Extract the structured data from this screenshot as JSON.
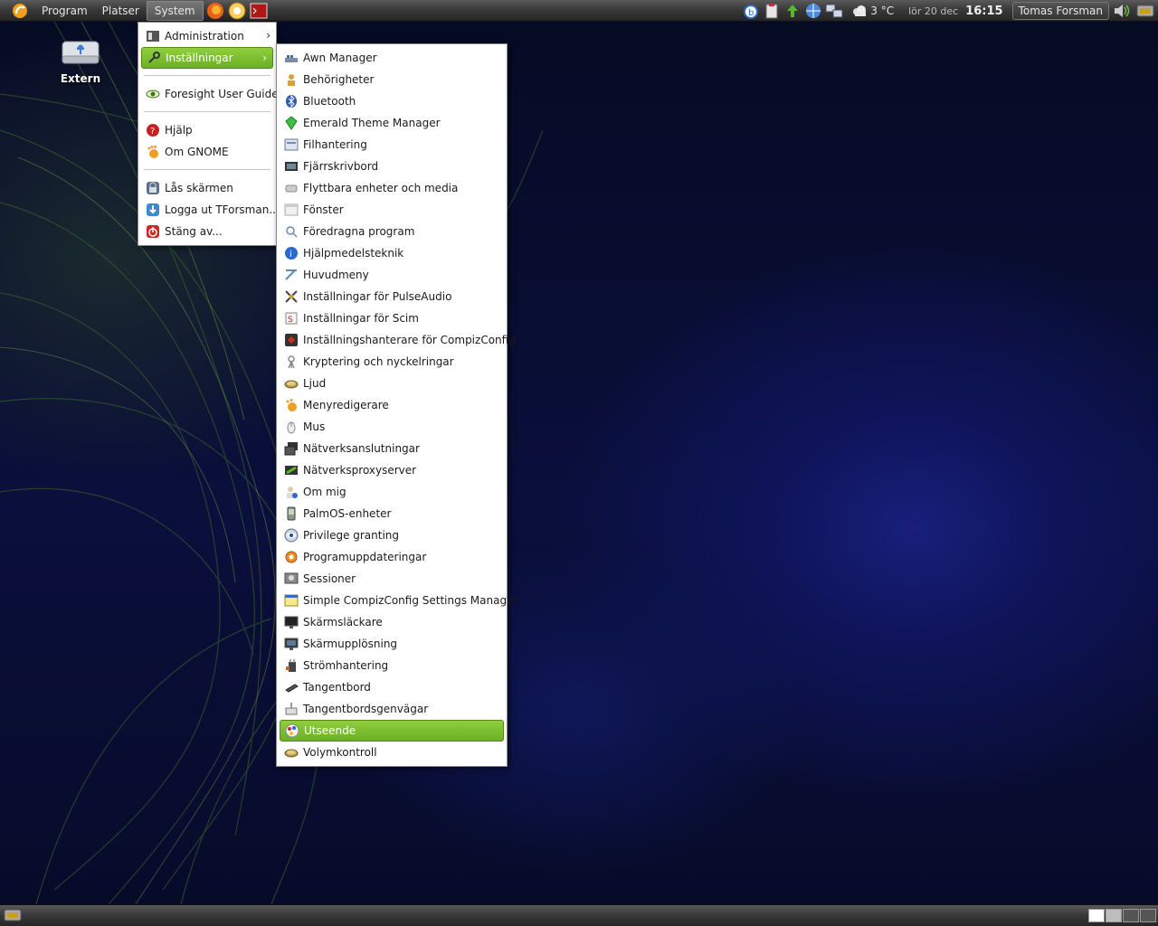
{
  "top_panel": {
    "menus": [
      "Program",
      "Platser",
      "System"
    ],
    "active_menu": "System",
    "weather": "3 °C",
    "date": "lör 20 dec",
    "time": "16:15",
    "user": "Tomas Forsman"
  },
  "desktop": {
    "icons": [
      {
        "label": "Extern",
        "icon": "usb-drive-icon"
      }
    ]
  },
  "system_menu": {
    "items": [
      {
        "label": "Administration",
        "icon": "administration-icon",
        "submenu": true
      },
      {
        "label": "Inställningar",
        "icon": "preferences-icon",
        "submenu": true,
        "highlighted": true
      },
      {
        "separator": true
      },
      {
        "label": "Foresight User Guide",
        "icon": "eye-icon"
      },
      {
        "separator": true
      },
      {
        "label": "Hjälp",
        "icon": "help-icon"
      },
      {
        "label": "Om GNOME",
        "icon": "gnome-foot-icon"
      },
      {
        "separator": true
      },
      {
        "label": "Lås skärmen",
        "icon": "lock-screen-icon"
      },
      {
        "label": "Logga ut TForsman...",
        "icon": "logout-icon"
      },
      {
        "label": "Stäng av...",
        "icon": "shutdown-icon"
      }
    ]
  },
  "settings_menu": {
    "items": [
      {
        "label": "Awn Manager",
        "icon": "awn-icon"
      },
      {
        "label": "Behörigheter",
        "icon": "permissions-icon"
      },
      {
        "label": "Bluetooth",
        "icon": "bluetooth-icon"
      },
      {
        "label": "Emerald Theme Manager",
        "icon": "emerald-icon"
      },
      {
        "label": "Filhantering",
        "icon": "file-management-icon"
      },
      {
        "label": "Fjärrskrivbord",
        "icon": "remote-desktop-icon"
      },
      {
        "label": "Flyttbara enheter och media",
        "icon": "removable-media-icon"
      },
      {
        "label": "Fönster",
        "icon": "window-icon"
      },
      {
        "label": "Föredragna program",
        "icon": "preferred-apps-icon"
      },
      {
        "label": "Hjälpmedelsteknik",
        "icon": "accessibility-icon"
      },
      {
        "label": "Huvudmeny",
        "icon": "main-menu-icon"
      },
      {
        "label": "Inställningar för PulseAudio",
        "icon": "pulseaudio-icon"
      },
      {
        "label": "Inställningar för Scim",
        "icon": "scim-icon"
      },
      {
        "label": "Inställningshanterare för CompizConfig",
        "icon": "compizconfig-icon"
      },
      {
        "label": "Kryptering och nyckelringar",
        "icon": "encryption-icon"
      },
      {
        "label": "Ljud",
        "icon": "sound-icon"
      },
      {
        "label": "Menyredigerare",
        "icon": "menu-editor-icon"
      },
      {
        "label": "Mus",
        "icon": "mouse-icon"
      },
      {
        "label": "Nätverksanslutningar",
        "icon": "network-connections-icon"
      },
      {
        "label": "Nätverksproxyserver",
        "icon": "network-proxy-icon"
      },
      {
        "label": "Om mig",
        "icon": "about-me-icon"
      },
      {
        "label": "PalmOS-enheter",
        "icon": "palmos-icon"
      },
      {
        "label": "Privilege granting",
        "icon": "privilege-icon"
      },
      {
        "label": "Programuppdateringar",
        "icon": "software-updates-icon"
      },
      {
        "label": "Sessioner",
        "icon": "sessions-icon"
      },
      {
        "label": "Simple CompizConfig Settings Manager",
        "icon": "simple-ccsm-icon"
      },
      {
        "label": "Skärmsläckare",
        "icon": "screensaver-icon"
      },
      {
        "label": "Skärmupplösning",
        "icon": "screen-resolution-icon"
      },
      {
        "label": "Strömhantering",
        "icon": "power-management-icon"
      },
      {
        "label": "Tangentbord",
        "icon": "keyboard-icon"
      },
      {
        "label": "Tangentbordsgenvägar",
        "icon": "keyboard-shortcuts-icon"
      },
      {
        "label": "Utseende",
        "icon": "appearance-icon",
        "highlighted": true
      },
      {
        "label": "Volymkontroll",
        "icon": "volume-control-icon"
      }
    ]
  },
  "colors": {
    "highlight": "#7cc032",
    "panel": "#3a3a3a",
    "wallpaper": "#0a0f3c"
  }
}
